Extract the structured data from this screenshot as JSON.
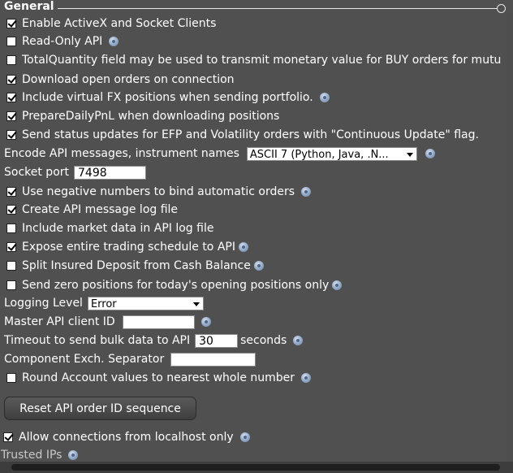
{
  "group": {
    "title": "General"
  },
  "rows": [
    {
      "label": "Enable ActiveX and Socket Clients",
      "checked": true
    },
    {
      "label": "Read-Only API",
      "checked": false
    },
    {
      "label": "TotalQuantity field may be used to transmit monetary value for BUY orders for mutu",
      "checked": false
    },
    {
      "label": "Download open orders on connection",
      "checked": true
    },
    {
      "label": "Include virtual FX positions when sending portfolio.",
      "checked": true
    },
    {
      "label": "PrepareDailyPnL when downloading positions",
      "checked": true
    },
    {
      "label": "Send status updates for EFP and Volatility orders with \"Continuous Update\" flag.",
      "checked": true
    }
  ],
  "encode": {
    "label": "Encode API messages, instrument names",
    "value": "ASCII 7 (Python, Java, .N..."
  },
  "socket_port": {
    "label": "Socket port",
    "value": "7498"
  },
  "rows2": [
    {
      "label": "Use negative numbers to bind automatic orders",
      "checked": true
    },
    {
      "label": "Create API message log file",
      "checked": true
    },
    {
      "label": "Include market data in API log file",
      "checked": false
    },
    {
      "label": "Expose entire trading schedule to API",
      "checked": true
    },
    {
      "label": "Split Insured Deposit from Cash Balance",
      "checked": false
    },
    {
      "label": "Send zero positions for today's opening positions only",
      "checked": false
    }
  ],
  "logging": {
    "label": "Logging Level",
    "value": "Error"
  },
  "master_client": {
    "label": "Master API client ID",
    "value": ""
  },
  "timeout": {
    "label": "Timeout to send bulk data to API",
    "value": "30",
    "unit": "seconds"
  },
  "separator": {
    "label": "Component Exch. Separator",
    "value": ""
  },
  "round": {
    "label": "Round Account values to nearest whole number",
    "checked": false
  },
  "reset_button": {
    "label": "Reset API order ID sequence"
  },
  "localhost": {
    "label": "Allow connections from localhost only",
    "checked": true
  },
  "trusted_ips": {
    "label": "Trusted IPs"
  }
}
